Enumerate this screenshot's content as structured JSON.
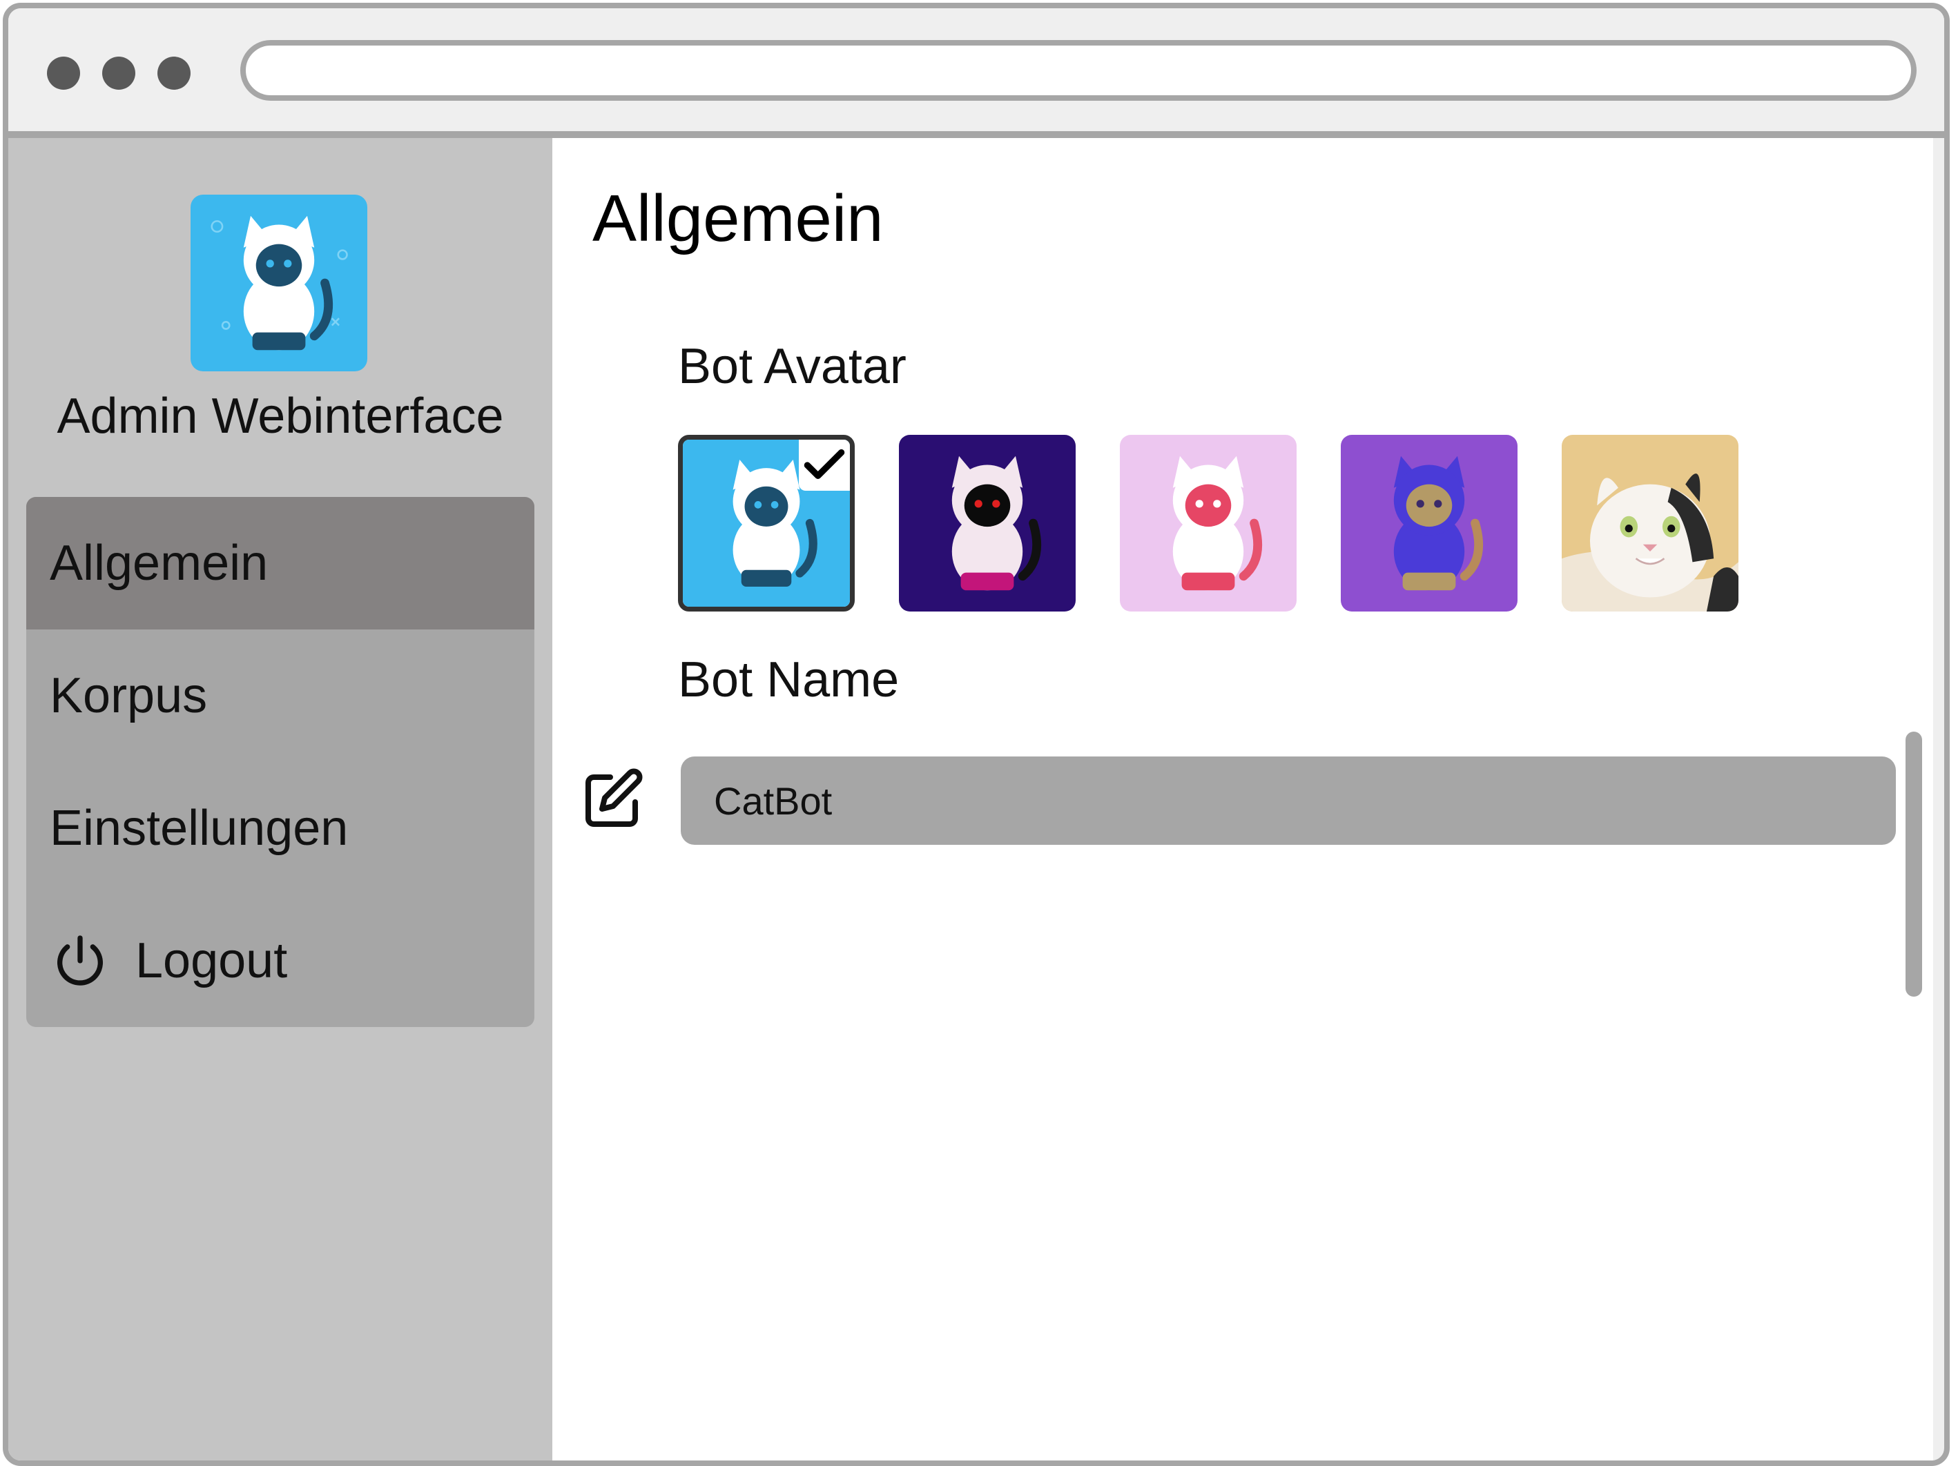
{
  "browser": {
    "url": ""
  },
  "sidebar": {
    "title": "Admin Webinterface",
    "items": [
      {
        "label": "Allgemein",
        "active": true
      },
      {
        "label": "Korpus",
        "active": false
      },
      {
        "label": "Einstellungen",
        "active": false
      },
      {
        "label": "Logout",
        "active": false,
        "icon": "power-icon"
      }
    ]
  },
  "main": {
    "title": "Allgemein",
    "avatar_section": {
      "label": "Bot Avatar",
      "options": [
        {
          "name": "cat-avatar-blue",
          "selected": true
        },
        {
          "name": "cat-avatar-dark-purple",
          "selected": false
        },
        {
          "name": "cat-avatar-pink",
          "selected": false
        },
        {
          "name": "cat-avatar-violet",
          "selected": false
        },
        {
          "name": "cat-photo",
          "selected": false
        }
      ]
    },
    "name_section": {
      "label": "Bot Name",
      "value": "CatBot",
      "icon": "edit-icon"
    }
  },
  "colors": {
    "sidebar_bg": "#c4c4c4",
    "nav_bg": "#a6a6a6",
    "nav_active": "#858282",
    "field_bg": "#a6a6a6"
  }
}
